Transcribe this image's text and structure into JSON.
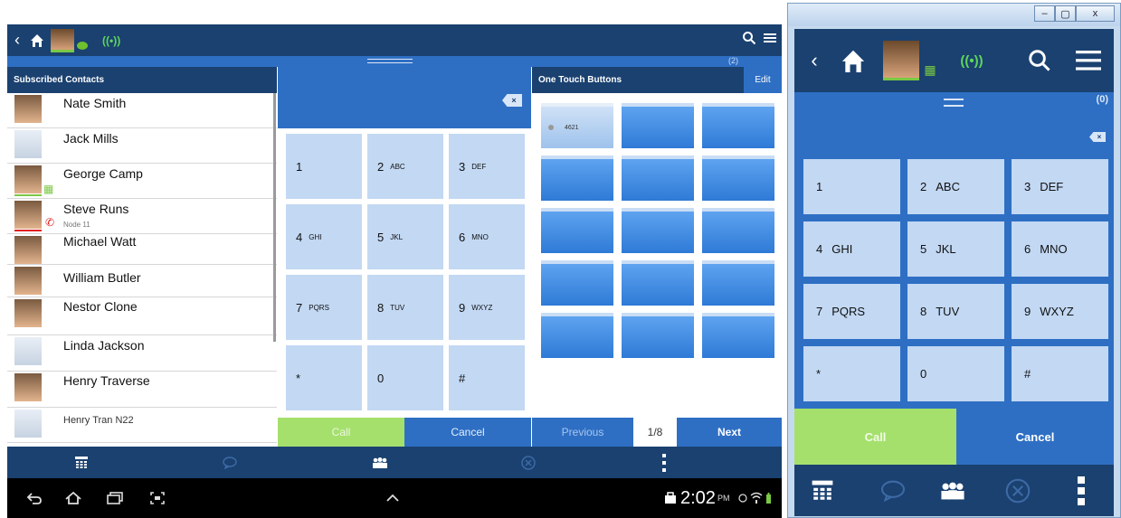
{
  "tablet": {
    "status": {
      "back_icon": "chevron-left-icon",
      "home_icon": "home-icon",
      "presence_color": "#7ac943",
      "signal_icon": "signal-icon",
      "signal_text": "((•))"
    },
    "handle_count": "(2)",
    "contacts": {
      "header": "Subscribed Contacts",
      "items": [
        {
          "name": "Nate Smith",
          "sub": ""
        },
        {
          "name": "Jack Mills",
          "sub": ""
        },
        {
          "name": "George Camp",
          "sub": ""
        },
        {
          "name": "Steve Runs",
          "sub": "Node 11"
        },
        {
          "name": "Michael Watt",
          "sub": ""
        },
        {
          "name": "William Butler",
          "sub": ""
        },
        {
          "name": "Nestor Clone",
          "sub": ""
        },
        {
          "name": "Linda Jackson",
          "sub": ""
        },
        {
          "name": "Henry Traverse",
          "sub": ""
        },
        {
          "name": "Henry Tran N22",
          "sub": ""
        }
      ]
    },
    "dialpad": {
      "backspace_label": "×",
      "keys": [
        {
          "num": "1",
          "ltr": ""
        },
        {
          "num": "2",
          "ltr": "ABC"
        },
        {
          "num": "3",
          "ltr": "DEF"
        },
        {
          "num": "4",
          "ltr": "GHI"
        },
        {
          "num": "5",
          "ltr": "JKL"
        },
        {
          "num": "6",
          "ltr": "MNO"
        },
        {
          "num": "7",
          "ltr": "PQRS"
        },
        {
          "num": "8",
          "ltr": "TUV"
        },
        {
          "num": "9",
          "ltr": "WXYZ"
        },
        {
          "num": "*",
          "ltr": ""
        },
        {
          "num": "0",
          "ltr": ""
        },
        {
          "num": "#",
          "ltr": ""
        }
      ],
      "call_label": "Call",
      "cancel_label": "Cancel"
    },
    "one_touch": {
      "header": "One Touch Buttons",
      "edit_label": "Edit",
      "first_button": "4621",
      "prev_label": "Previous",
      "page": "1/8",
      "next_label": "Next"
    },
    "android": {
      "time": "2:02",
      "ampm": "PM"
    }
  },
  "window": {
    "minimize": "–",
    "maximize": "▢",
    "close": "x",
    "handle_count": "(0)",
    "backspace_label": "×",
    "keys": [
      {
        "num": "1",
        "ltr": ""
      },
      {
        "num": "2",
        "ltr": "ABC"
      },
      {
        "num": "3",
        "ltr": "DEF"
      },
      {
        "num": "4",
        "ltr": "GHI"
      },
      {
        "num": "5",
        "ltr": "JKL"
      },
      {
        "num": "6",
        "ltr": "MNO"
      },
      {
        "num": "7",
        "ltr": "PQRS"
      },
      {
        "num": "8",
        "ltr": "TUV"
      },
      {
        "num": "9",
        "ltr": "WXYZ"
      },
      {
        "num": "*",
        "ltr": ""
      },
      {
        "num": "0",
        "ltr": ""
      },
      {
        "num": "#",
        "ltr": ""
      }
    ],
    "call_label": "Call",
    "cancel_label": "Cancel"
  },
  "colors": {
    "navy": "#1a4170",
    "blue": "#2e6fc4",
    "key": "#c2d8f3",
    "call_green": "#a5e06d",
    "presence_green": "#7ac943",
    "busy_red": "#e02020"
  }
}
